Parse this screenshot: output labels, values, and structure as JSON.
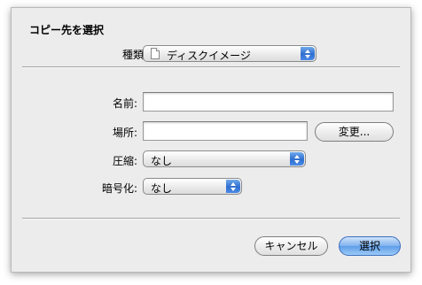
{
  "dialog": {
    "title": "コピー先を選択",
    "type_label": "種類:",
    "type_value": "ディスクイメージ",
    "name_label": "名前:",
    "name_value": "",
    "location_label": "場所:",
    "location_value": "",
    "change_button": "変更...",
    "compression_label": "圧縮:",
    "compression_value": "なし",
    "encryption_label": "暗号化:",
    "encryption_value": "なし",
    "cancel_button": "キャンセル",
    "select_button": "選択"
  }
}
